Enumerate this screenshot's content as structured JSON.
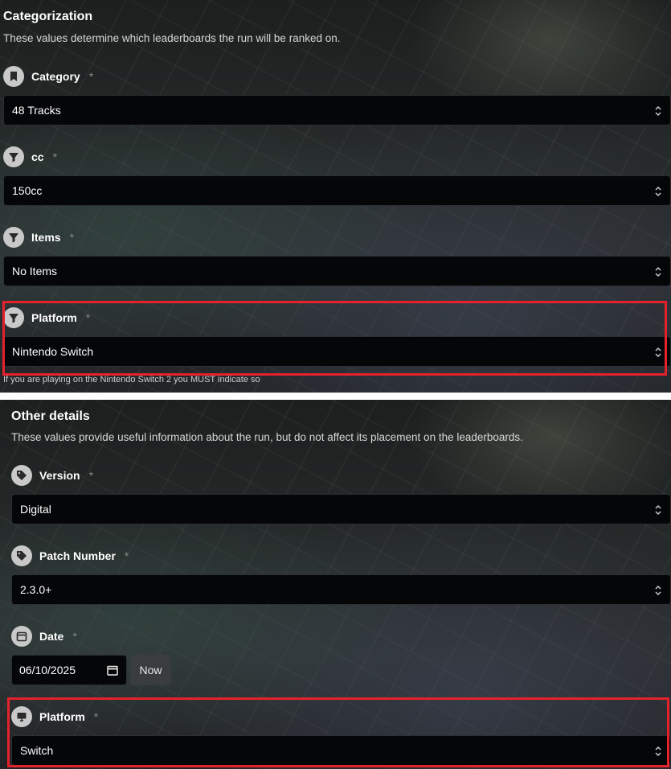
{
  "categorization": {
    "title": "Categorization",
    "description": "These values determine which leaderboards the run will be ranked on.",
    "required_mark": "*",
    "fields": [
      {
        "label": "Category",
        "icon": "bookmark-icon",
        "value": "48 Tracks"
      },
      {
        "label": "cc",
        "icon": "filter-icon",
        "value": "150cc"
      },
      {
        "label": "Items",
        "icon": "filter-icon",
        "value": "No Items"
      },
      {
        "label": "Platform",
        "icon": "filter-icon",
        "value": "Nintendo Switch",
        "hint": "If you are playing on the Nintendo Switch 2 you MUST indicate so"
      }
    ]
  },
  "other_details": {
    "title": "Other details",
    "description": "These values provide useful information about the run, but do not affect its placement on the leaderboards.",
    "required_mark": "*",
    "version": {
      "label": "Version",
      "icon": "tag-icon",
      "value": "Digital"
    },
    "patch": {
      "label": "Patch Number",
      "icon": "tag-icon",
      "value": "2.3.0+"
    },
    "date": {
      "label": "Date",
      "icon": "calendar-icon",
      "value": "06/10/2025",
      "now_label": "Now"
    },
    "platform": {
      "label": "Platform",
      "icon": "monitor-icon",
      "value": "Switch"
    }
  },
  "colors": {
    "highlight": "#e3222b",
    "input_bg": "#050608",
    "icon_bg": "#c9c9c9"
  }
}
